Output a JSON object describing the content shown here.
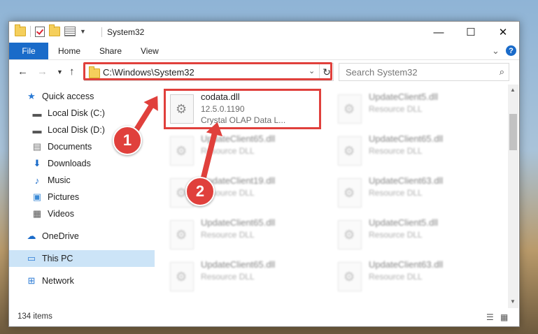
{
  "window": {
    "title": "System32"
  },
  "title_buttons": {
    "minimize": "—",
    "maximize": "☐",
    "close": "✕"
  },
  "ribbon": {
    "tabs": [
      "File",
      "Home",
      "Share",
      "View"
    ]
  },
  "address": {
    "path": "C:\\Windows\\System32"
  },
  "search": {
    "placeholder": "Search System32"
  },
  "nav": {
    "items": [
      {
        "label": "Quick access",
        "icon": "star-icon"
      },
      {
        "label": "Local Disk (C:)",
        "icon": "drive-icon"
      },
      {
        "label": "Local Disk (D:)",
        "icon": "drive-icon"
      },
      {
        "label": "Documents",
        "icon": "documents-icon"
      },
      {
        "label": "Downloads",
        "icon": "downloads-icon"
      },
      {
        "label": "Music",
        "icon": "music-icon"
      },
      {
        "label": "Pictures",
        "icon": "pictures-icon"
      },
      {
        "label": "Videos",
        "icon": "videos-icon"
      },
      {
        "label": "OneDrive",
        "icon": "onedrive-icon"
      },
      {
        "label": "This PC",
        "icon": "this-pc-icon"
      },
      {
        "label": "Network",
        "icon": "network-icon"
      }
    ]
  },
  "files": [
    {
      "name": "codata.dll",
      "line1": "12.5.0.1190",
      "line2": "Crystal OLAP Data L..."
    },
    {
      "name": "UpdateClient5.dll",
      "line1": "Resource DLL"
    },
    {
      "name": "UpdateClient65.dll",
      "line1": "Resource DLL"
    },
    {
      "name": "UpdateClient65.dll",
      "line1": "Resource DLL"
    },
    {
      "name": "UpdateClient19.dll",
      "line1": "Resource DLL"
    },
    {
      "name": "UpdateClient63.dll",
      "line1": "Resource DLL"
    },
    {
      "name": "UpdateClient65.dll",
      "line1": "Resource DLL"
    },
    {
      "name": "UpdateClient5.dll",
      "line1": "Resource DLL"
    },
    {
      "name": "UpdateClient65.dll",
      "line1": "Resource DLL"
    },
    {
      "name": "UpdateClient63.dll",
      "line1": "Resource DLL"
    }
  ],
  "status": {
    "items": "134 items"
  },
  "annotations": {
    "badge1": "1",
    "badge2": "2"
  },
  "colors": {
    "accent": "#1a6bc9",
    "highlight": "#e0403c",
    "selection": "#cce4f7"
  }
}
